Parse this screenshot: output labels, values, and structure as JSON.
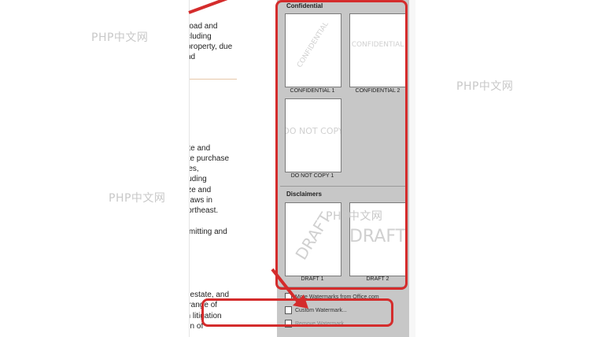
{
  "background_watermarks": [
    {
      "text": "PHP中文网"
    },
    {
      "text": "PHP中文网"
    },
    {
      "text": "PHP中文网"
    },
    {
      "text": "PHP中文网"
    }
  ],
  "document": {
    "lines": [
      "road and",
      "cluding",
      "property, due",
      "nd",
      "tate and",
      "iate purchase",
      "rties,",
      "cluding",
      "lyze and",
      "g laws in",
      "Northeast.",
      "e",
      "ermitting and",
      "al estate, and",
      "e range of",
      "on litigation",
      "tion of"
    ]
  },
  "gallery": {
    "groups": [
      {
        "title": "Confidential",
        "items": [
          {
            "thumb_text": "CONFIDENTIAL",
            "caption": "CONFIDENTIAL 1"
          },
          {
            "thumb_text": "CONFIDENTIAL",
            "caption": "CONFIDENTIAL 2"
          },
          {
            "thumb_text": "DO NOT COPY",
            "caption": "DO NOT COPY 1"
          }
        ]
      },
      {
        "title": "Disclaimers",
        "items": [
          {
            "thumb_text": "DRAFT",
            "caption": "DRAFT 1"
          },
          {
            "thumb_text": "DRAFT",
            "caption": "DRAFT 2"
          }
        ]
      }
    ]
  },
  "menu": {
    "more_watermarks": "More Watermarks from Office.com",
    "custom_watermark": "Custom Watermark...",
    "remove_watermark": "Remove Watermark"
  },
  "colors": {
    "annotation_red": "#d42c2c",
    "gallery_bg": "#c7c7c7"
  }
}
